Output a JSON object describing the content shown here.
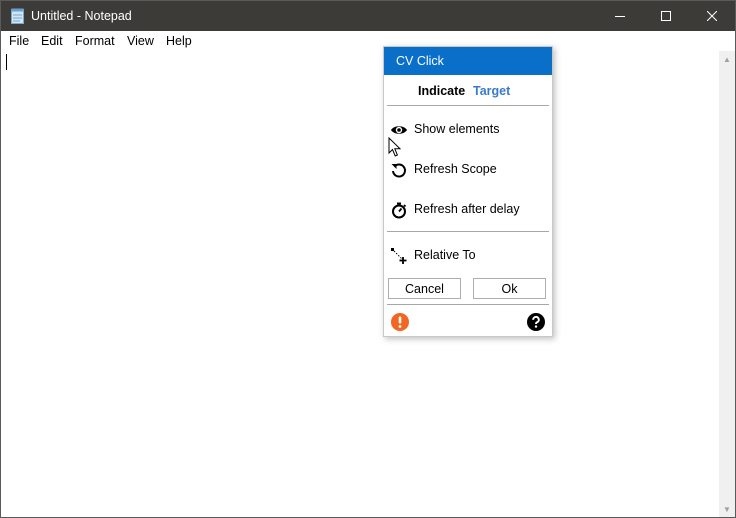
{
  "window": {
    "title": "Untitled - Notepad",
    "icons": {
      "app": "notepad-icon",
      "minimize": "minimize-icon",
      "maximize": "maximize-icon",
      "close": "close-icon"
    }
  },
  "menu": {
    "file": "File",
    "edit": "Edit",
    "format": "Format",
    "view": "View",
    "help": "Help"
  },
  "editor": {
    "content": ""
  },
  "popup": {
    "title": "CV Click",
    "header_color": "#0a6fc8",
    "tabs": {
      "indicate": "Indicate",
      "target": "Target"
    },
    "actions": {
      "show_elements": {
        "label": "Show elements",
        "icon": "eye-icon"
      },
      "refresh_scope": {
        "label": "Refresh Scope",
        "icon": "refresh-icon"
      },
      "refresh_delay": {
        "label": "Refresh after delay",
        "icon": "stopwatch-icon"
      },
      "relative_to": {
        "label": "Relative To",
        "icon": "relative-to-icon"
      }
    },
    "buttons": {
      "cancel": "Cancel",
      "ok": "Ok"
    },
    "footer": {
      "warning_icon": "warning-icon",
      "warning_color": "#f26522",
      "help_icon": "help-icon"
    }
  }
}
